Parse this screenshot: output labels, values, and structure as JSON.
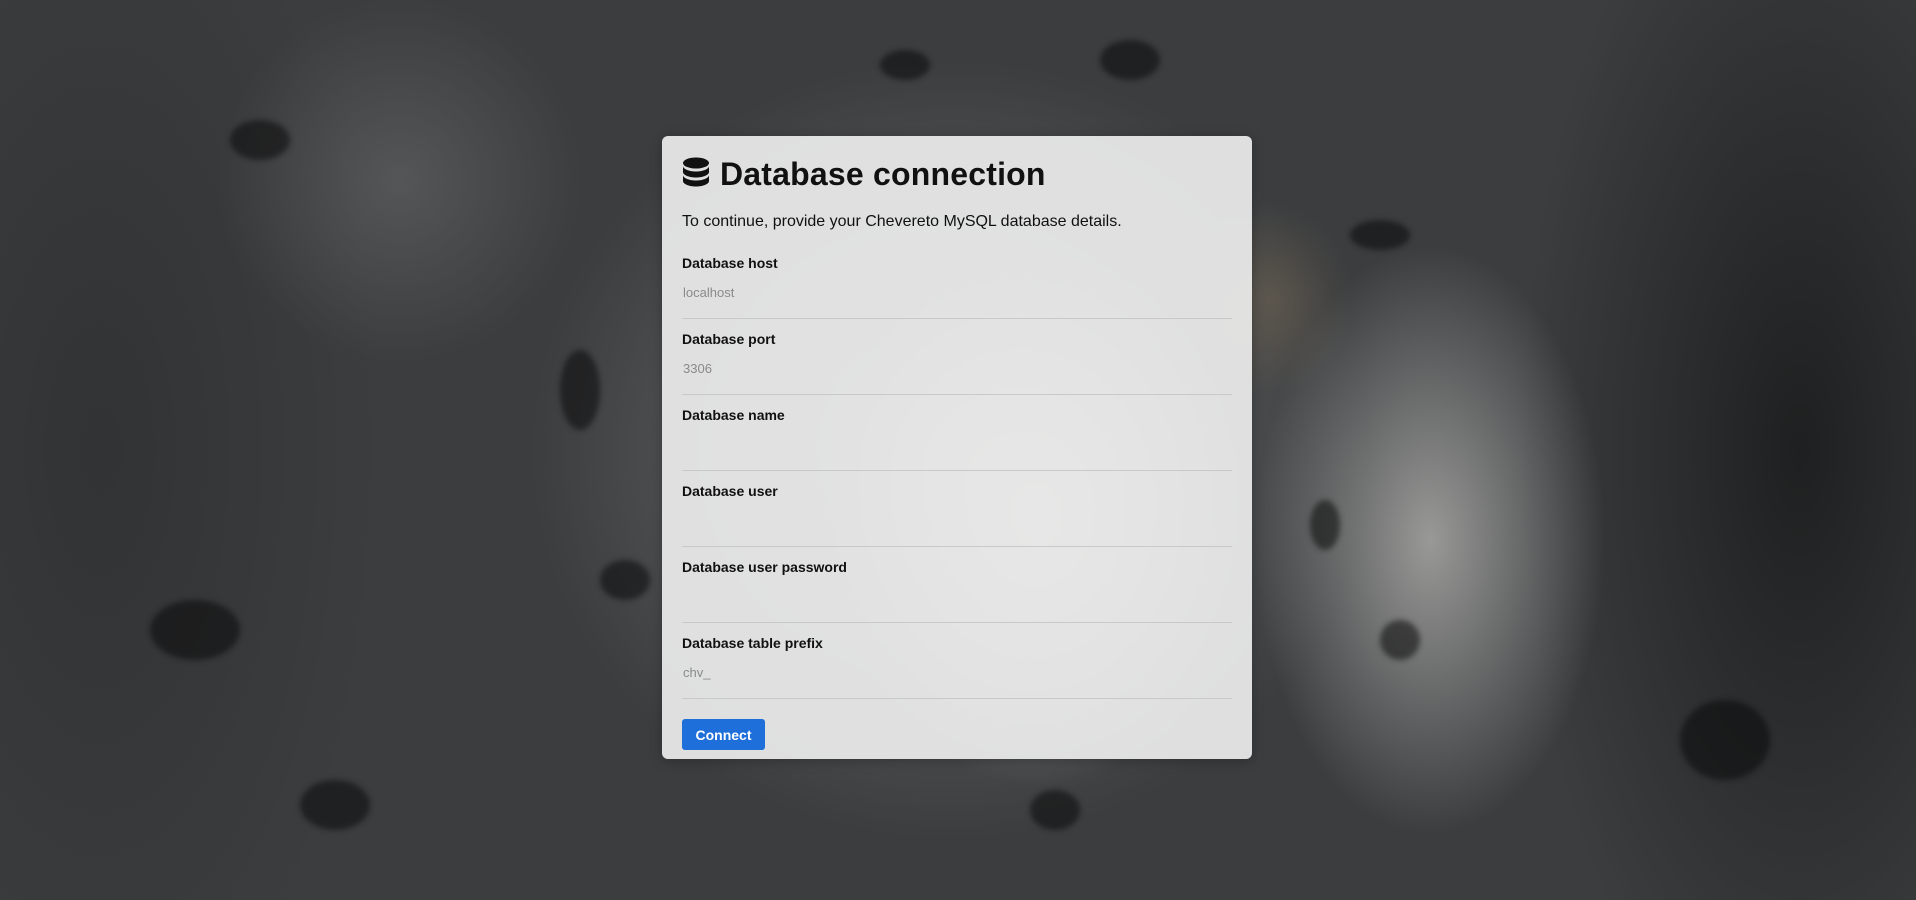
{
  "background": {
    "description_icon": "background-photo"
  },
  "form": {
    "icon": "database-icon",
    "title": "Database connection",
    "intro": "To continue, provide your Chevereto MySQL database details.",
    "fields": [
      {
        "label": "Database host",
        "value": "",
        "placeholder": "localhost",
        "type": "text"
      },
      {
        "label": "Database port",
        "value": "",
        "placeholder": "3306",
        "type": "text"
      },
      {
        "label": "Database name",
        "value": "",
        "placeholder": "",
        "type": "text"
      },
      {
        "label": "Database user",
        "value": "",
        "placeholder": "",
        "type": "text"
      },
      {
        "label": "Database user password",
        "value": "",
        "placeholder": "",
        "type": "password"
      },
      {
        "label": "Database table prefix",
        "value": "",
        "placeholder": "chv_",
        "type": "text"
      }
    ],
    "submit_label": "Connect"
  },
  "colors": {
    "accent": "#1e6fd9",
    "card": "#ececec"
  }
}
